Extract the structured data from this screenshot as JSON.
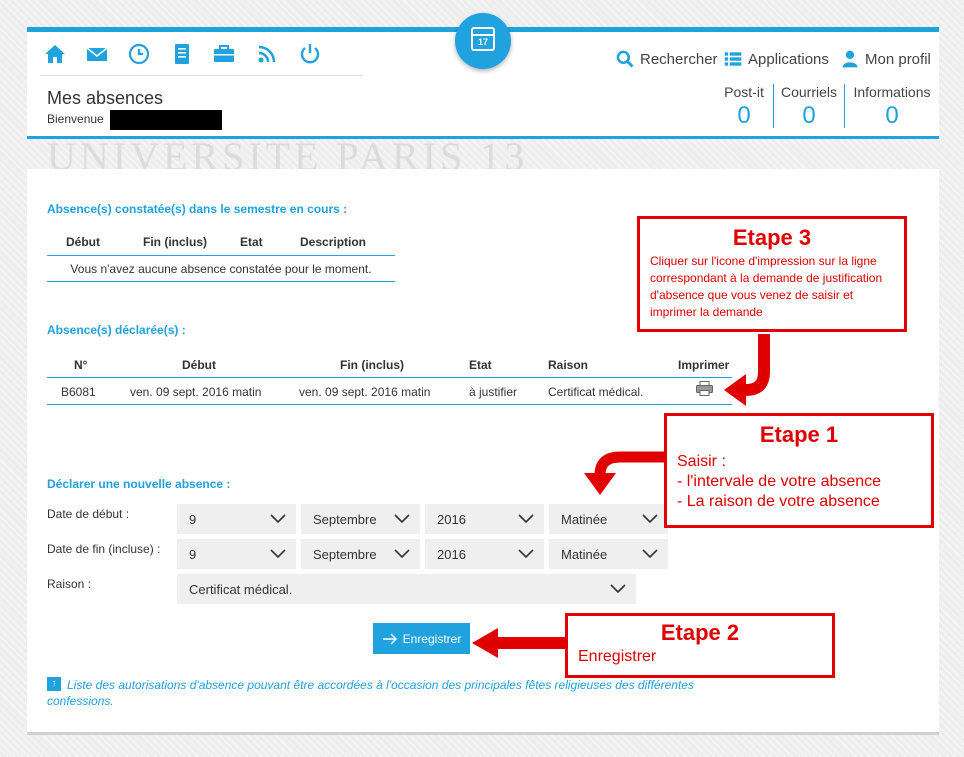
{
  "nav": {
    "icons": [
      "home-icon",
      "mail-icon",
      "clock-icon",
      "notebook-icon",
      "briefcase-icon",
      "rss-icon",
      "power-icon"
    ],
    "calendar_day": "17",
    "search_label": "Rechercher",
    "applications_label": "Applications",
    "profile_label": "Mon profil"
  },
  "header": {
    "title": "Mes absences",
    "welcome": "Bienvenue"
  },
  "counters": [
    {
      "label": "Post-it",
      "value": "0"
    },
    {
      "label": "Courriels",
      "value": "0"
    },
    {
      "label": "Informations",
      "value": "0"
    }
  ],
  "watermark": "UNIVERSITE PARIS 13",
  "observed": {
    "title": "Absence(s) constatée(s) dans le semestre en cours :",
    "columns": [
      "Début",
      "Fin (inclus)",
      "Etat",
      "Description"
    ],
    "empty_message": "Vous n'avez aucune absence constatée pour le moment."
  },
  "declared": {
    "title": "Absence(s) déclarée(s) :",
    "columns": [
      "N°",
      "Début",
      "Fin (inclus)",
      "Etat",
      "Raison",
      "Imprimer"
    ],
    "rows": [
      {
        "number": "B6081",
        "start": "ven. 09 sept. 2016 matin",
        "end": "ven. 09 sept. 2016 matin",
        "state": "à justifier",
        "reason": "Certificat médical."
      }
    ]
  },
  "new_absence": {
    "title": "Déclarer une nouvelle absence :",
    "start_label": "Date de début :",
    "end_label": "Date de fin (incluse) :",
    "reason_label": "Raison :",
    "start": {
      "day": "9",
      "month": "Septembre",
      "year": "2016",
      "period": "Matinée"
    },
    "end": {
      "day": "9",
      "month": "Septembre",
      "year": "2016",
      "period": "Matinée"
    },
    "reason": "Certificat médical.",
    "save_label": "Enregistrer"
  },
  "info_link": "Liste des autorisations d'absence pouvant être accordées à l'occasion des principales fêtes religieuses des différentes confessions.",
  "annotations": {
    "step3_title": "Etape 3",
    "step3_text": "Cliquer sur l'icone d'impression sur la ligne correspondant à la demande de justification d'absence que vous venez de saisir et imprimer la demande",
    "step1_title": "Etape 1",
    "step1_line1": "Saisir :",
    "step1_line2": "- l'intervale de votre absence",
    "step1_line3": "- La raison de votre absence",
    "step2_title": "Etape 2",
    "step2_text": "Enregistrer",
    "color": "#e00000"
  },
  "colors": {
    "accent": "#1fa2dd",
    "annotation": "#e00000"
  }
}
